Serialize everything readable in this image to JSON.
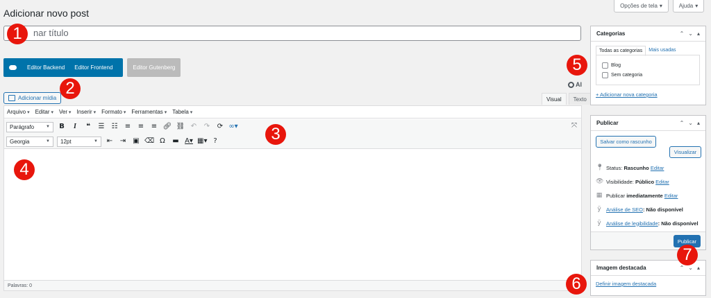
{
  "top": {
    "screen_options": "Opções de tela",
    "help": "Ajuda"
  },
  "page_title": "Adicionar novo post",
  "title_input": {
    "placeholder_visible": "nar título"
  },
  "wpbakery": {
    "backend": "Editor Backend",
    "frontend": "Editor Frontend",
    "gutenberg": "Editor Gutenberg"
  },
  "add_media": "Adicionar mídia",
  "ai_label": "AI",
  "editor_tabs": {
    "visual": "Visual",
    "text": "Texto"
  },
  "menubar": [
    "Arquivo",
    "Editar",
    "Ver",
    "Inserir",
    "Formato",
    "Ferramentas",
    "Tabela"
  ],
  "toolbar": {
    "paragraph": "Parágrafo",
    "font": "Georgia",
    "size": "12pt"
  },
  "statusbar": "Palavras: 0",
  "categories": {
    "title": "Categorias",
    "tab_all": "Todas as categorias",
    "tab_used": "Mais usadas",
    "items": [
      "Blog",
      "Sem categoria"
    ],
    "add_new": "+ Adicionar nova categoria"
  },
  "publish": {
    "title": "Publicar",
    "save_draft": "Salvar como rascunho",
    "preview": "Visualizar",
    "status_label": "Status:",
    "status_value": "Rascunho",
    "visibility_label": "Visibilidade:",
    "visibility_value": "Público",
    "publish_label": "Publicar",
    "publish_value": "imediatamente",
    "edit": "Editar",
    "seo_link": "Análise de SEO",
    "seo_value": ": Não disponível",
    "read_link": "Análise de legibilidade",
    "read_value": ": Não disponível",
    "publish_button": "Publicar"
  },
  "featured": {
    "title": "Imagem destacada",
    "link": "Definir imagem destacada"
  },
  "callouts": [
    "1",
    "2",
    "3",
    "4",
    "5",
    "6",
    "7"
  ],
  "colors": {
    "callout": "#e8160c",
    "primary": "#2271b1",
    "wpbakery": "#0073aa"
  }
}
